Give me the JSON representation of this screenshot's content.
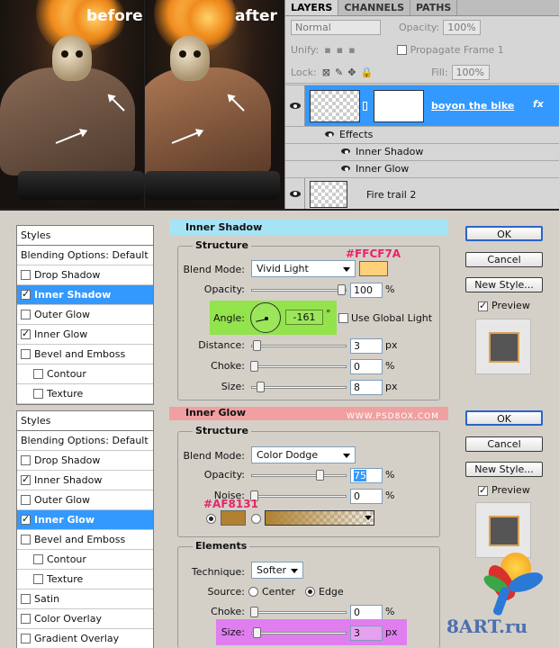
{
  "photos": {
    "before_label": "before",
    "after_label": "after"
  },
  "layers_panel": {
    "tabs": [
      "LAYERS",
      "CHANNELS",
      "PATHS"
    ],
    "blend_mode": "Normal",
    "opacity_label": "Opacity:",
    "opacity_value": "100%",
    "unify_label": "Unify:",
    "propagate_label": "Propagate Frame 1",
    "lock_label": "Lock:",
    "fill_label": "Fill:",
    "fill_value": "100%",
    "layer1_name": "boyon the bike",
    "fx_label": "fx",
    "effects_label": "Effects",
    "effect1": "Inner Shadow",
    "effect2": "Inner Glow",
    "layer2_name": "Fire trail 2"
  },
  "dialog1": {
    "styles_header": "Styles",
    "items": [
      {
        "label": "Blending Options: Default",
        "checkbox": false,
        "checked": false,
        "selected": false,
        "sub": false
      },
      {
        "label": "Drop Shadow",
        "checkbox": true,
        "checked": false,
        "selected": false,
        "sub": false
      },
      {
        "label": "Inner Shadow",
        "checkbox": true,
        "checked": true,
        "selected": true,
        "sub": false
      },
      {
        "label": "Outer Glow",
        "checkbox": true,
        "checked": false,
        "selected": false,
        "sub": false
      },
      {
        "label": "Inner Glow",
        "checkbox": true,
        "checked": true,
        "selected": false,
        "sub": false
      },
      {
        "label": "Bevel and Emboss",
        "checkbox": true,
        "checked": false,
        "selected": false,
        "sub": false
      },
      {
        "label": "Contour",
        "checkbox": true,
        "checked": false,
        "selected": false,
        "sub": true
      },
      {
        "label": "Texture",
        "checkbox": true,
        "checked": false,
        "selected": false,
        "sub": true
      }
    ],
    "section_title": "Inner Shadow",
    "structure_legend": "Structure",
    "color_annotation": "#FFCF7A",
    "swatch_color": "#FFCF7A",
    "blend_mode_label": "Blend Mode:",
    "blend_mode_value": "Vivid Light",
    "opacity_label": "Opacity:",
    "opacity_value": "100",
    "angle_label": "Angle:",
    "angle_value": "-161",
    "angle_unit": "°",
    "global_light_label": "Use Global Light",
    "distance_label": "Distance:",
    "distance_value": "3",
    "choke_label": "Choke:",
    "choke_value": "0",
    "size_label": "Size:",
    "size_value": "8",
    "percent": "%",
    "px": "px",
    "ok": "OK",
    "cancel": "Cancel",
    "new_style": "New Style...",
    "preview": "Preview"
  },
  "dialog2": {
    "styles_header": "Styles",
    "items": [
      {
        "label": "Blending Options: Default",
        "checkbox": false,
        "checked": false,
        "selected": false,
        "sub": false
      },
      {
        "label": "Drop Shadow",
        "checkbox": true,
        "checked": false,
        "selected": false,
        "sub": false
      },
      {
        "label": "Inner Shadow",
        "checkbox": true,
        "checked": true,
        "selected": false,
        "sub": false
      },
      {
        "label": "Outer Glow",
        "checkbox": true,
        "checked": false,
        "selected": false,
        "sub": false
      },
      {
        "label": "Inner Glow",
        "checkbox": true,
        "checked": true,
        "selected": true,
        "sub": false
      },
      {
        "label": "Bevel and Emboss",
        "checkbox": true,
        "checked": false,
        "selected": false,
        "sub": false
      },
      {
        "label": "Contour",
        "checkbox": true,
        "checked": false,
        "selected": false,
        "sub": true
      },
      {
        "label": "Texture",
        "checkbox": true,
        "checked": false,
        "selected": false,
        "sub": true
      },
      {
        "label": "Satin",
        "checkbox": true,
        "checked": false,
        "selected": false,
        "sub": false
      },
      {
        "label": "Color Overlay",
        "checkbox": true,
        "checked": false,
        "selected": false,
        "sub": false
      },
      {
        "label": "Gradient Overlay",
        "checkbox": true,
        "checked": false,
        "selected": false,
        "sub": false
      }
    ],
    "section_title": "Inner Glow",
    "watermark": "WWW.PSD8OX.COM",
    "structure_legend": "Structure",
    "blend_mode_label": "Blend Mode:",
    "blend_mode_value": "Color Dodge",
    "opacity_label": "Opacity:",
    "opacity_value": "75",
    "noise_label": "Noise:",
    "noise_value": "0",
    "color_annotation": "#AF8131",
    "swatch_color": "#AF8131",
    "elements_legend": "Elements",
    "technique_label": "Technique:",
    "technique_value": "Softer",
    "source_label": "Source:",
    "source_center": "Center",
    "source_edge": "Edge",
    "choke_label": "Choke:",
    "choke_value": "0",
    "size_label": "Size:",
    "size_value": "3",
    "percent": "%",
    "px": "px",
    "ok": "OK",
    "cancel": "Cancel",
    "new_style": "New Style...",
    "preview": "Preview"
  },
  "logo": {
    "text": "8ART.ru"
  },
  "colors": {
    "highlight_cyan": "#a6e4f5",
    "highlight_red": "#f0a0a0",
    "highlight_green": "#93e34c",
    "highlight_magenta": "#e07ef0",
    "selection_blue": "#3399ff",
    "annotation_pink": "#e8246b"
  }
}
